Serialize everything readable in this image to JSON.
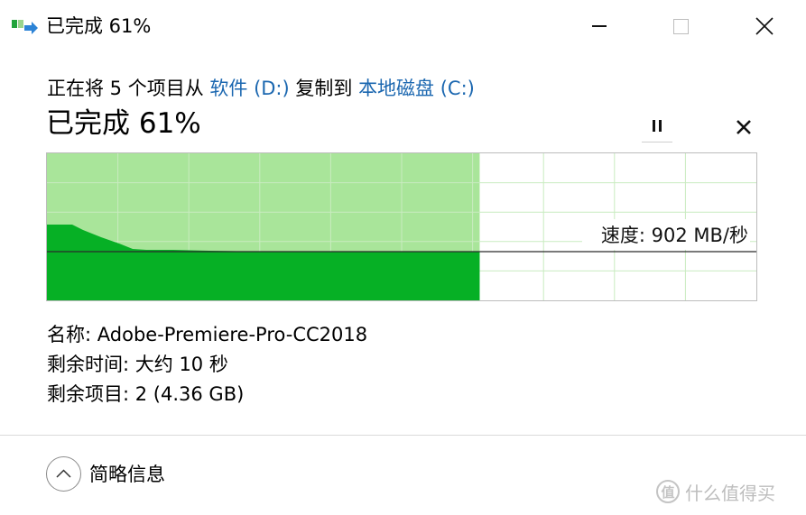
{
  "window": {
    "title": "已完成 61%",
    "icon": "file-copy-icon",
    "controls": {
      "minimize_icon": "minimize-icon",
      "maximize_icon": "maximize-icon",
      "close_icon": "close-icon"
    }
  },
  "copy": {
    "prefix": "正在将 5 个项目从 ",
    "source": "软件 (D:)",
    "middle": " 复制到 ",
    "destination": "本地磁盘 (C:)"
  },
  "status": {
    "label": "已完成 61%",
    "percent": 61
  },
  "actions": {
    "pause_icon": "pause-icon",
    "cancel_icon": "cancel-x-icon"
  },
  "graph": {
    "speed_text": "速度: 902 MB/秒",
    "progress_fraction": 0.61,
    "fill_color": "#06b025",
    "bg_fill_color": "#a9e59a",
    "grid_color": "#c9ebc0"
  },
  "details": {
    "name_label": "名称:",
    "name_value": "Adobe-Premiere-Pro-CC2018",
    "time_label": "剩余时间:",
    "time_value": "大约 10 秒",
    "items_label": "剩余项目:",
    "items_value": "2 (4.36 GB)"
  },
  "footer": {
    "collapse_label": "简略信息",
    "collapse_icon": "chevron-up-icon"
  },
  "watermark": {
    "glyph": "值",
    "text": "什么值得买"
  }
}
